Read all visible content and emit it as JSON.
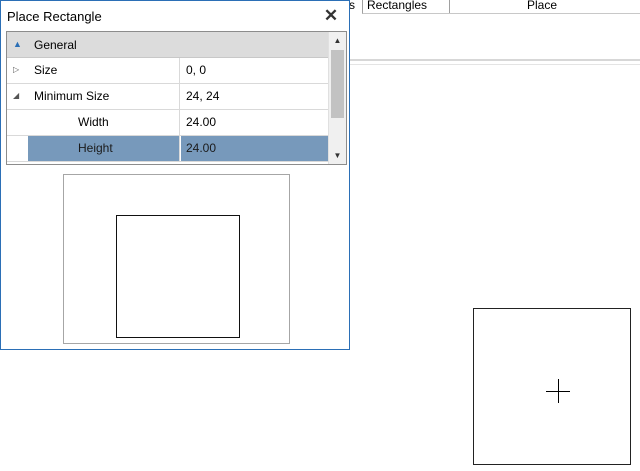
{
  "app": {
    "tabs": [
      {
        "label": "s"
      },
      {
        "label": "Rectangles"
      },
      {
        "label": "Place"
      }
    ]
  },
  "dialog": {
    "title": "Place Rectangle",
    "close_icon": "close-icon"
  },
  "property_grid": {
    "category": {
      "label": "General",
      "expanded": true
    },
    "rows": [
      {
        "name": "Size",
        "value": "0, 0",
        "expandable": true,
        "expanded": false
      },
      {
        "name": "Minimum Size",
        "value": "24, 24",
        "expandable": true,
        "expanded": true
      },
      {
        "name": "Width",
        "value": "24.00",
        "child": true
      },
      {
        "name": "Height",
        "value": "24.00",
        "child": true,
        "selected": true
      }
    ],
    "scrollbar": {
      "up_icon": "arrow-up-icon",
      "down_icon": "arrow-down-icon"
    }
  },
  "colors": {
    "dialog_border": "#2b6fb6",
    "selection": "#7799bb",
    "category_background": "#dcdcdc"
  }
}
